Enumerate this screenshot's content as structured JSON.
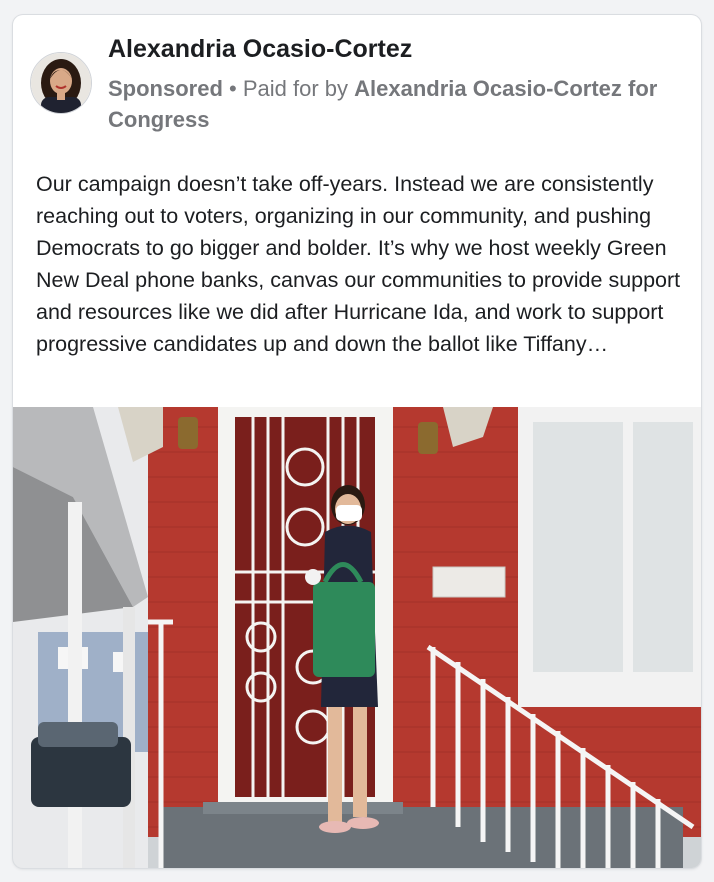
{
  "post": {
    "author": "Alexandria Ocasio-Cortez",
    "sponsored_label": "Sponsored",
    "separator": " • ",
    "paid_for_prefix": "Paid for by ",
    "paid_for_by": "Alexandria Ocasio-Cortez for Congress",
    "text": "Our campaign doesn’t take off-years. Instead we are consistently reaching out to voters, organizing in our community, and pushing Democrats to go bigger and bolder. It’s why we host weekly Green New Deal phone banks, canvas our communities to provide support and resources like we did after Hurricane Ida, and work to support progressive candidates up and down the ballot like Tiffany…",
    "avatar_icon": "profile-photo",
    "photo_description_icon": "ad-photo"
  },
  "colors": {
    "meta_text": "#75777b",
    "brick": "#b5392f",
    "bag_green": "#2e8a5a"
  }
}
